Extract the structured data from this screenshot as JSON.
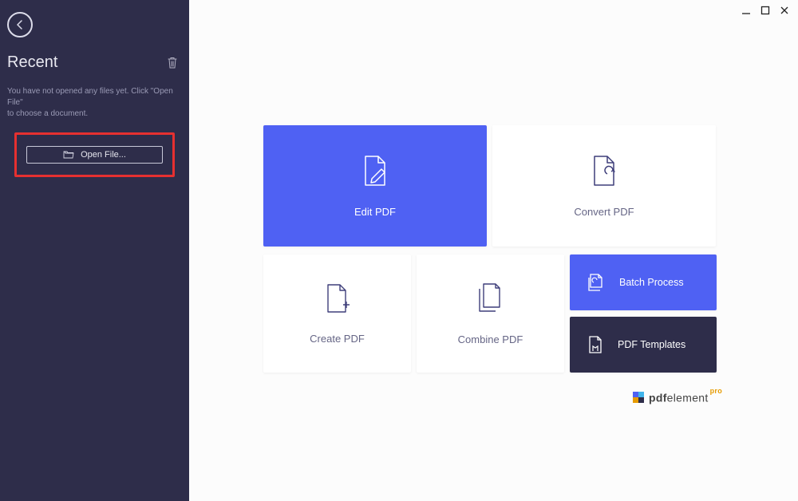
{
  "sidebar": {
    "recent_title": "Recent",
    "empty_text_l1": "You have not opened any files yet. Click \"Open File\"",
    "empty_text_l2": "to choose a document.",
    "open_file_label": "Open File..."
  },
  "tiles": {
    "edit_pdf": "Edit PDF",
    "convert_pdf": "Convert PDF",
    "create_pdf": "Create PDF",
    "combine_pdf": "Combine PDF",
    "batch_process": "Batch Process",
    "pdf_templates": "PDF Templates"
  },
  "brand": {
    "name_bold": "pdf",
    "name_rest": "element",
    "suffix": "pro"
  },
  "colors": {
    "sidebar_bg": "#2e2d4a",
    "accent": "#4f61f3",
    "highlight": "#e63030",
    "brand_orange": "#e69b00"
  }
}
